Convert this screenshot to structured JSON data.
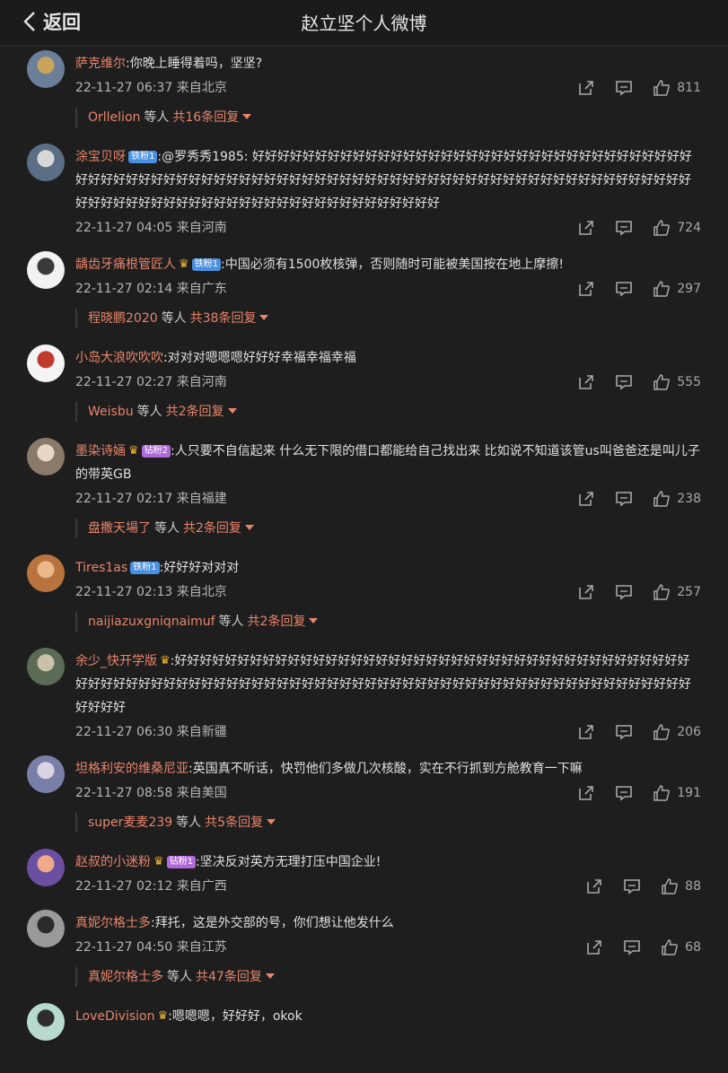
{
  "header": {
    "back_label": "返回",
    "title": "赵立坚个人微博"
  },
  "comments": [
    {
      "name": "萨克维尔",
      "badge": "",
      "crown": false,
      "text": ":你晚上睡得着吗，坚坚?",
      "time": "22-11-27 06:37 来自北京",
      "likes": "811",
      "reply_user": "Orllelion",
      "reply_mid": "等人",
      "reply_total": "共16条回复"
    },
    {
      "name": "涂宝贝呀",
      "badge": "铁粉1",
      "crown": false,
      "text": ":@罗秀秀1985: 好好好好好好好好好好好好好好好好好好好好好好好好好好好好好好好好好好好好好好好好好好好好好好好好好好好好好好好好好好好好好好好好好好好好好好好好好好好好好好好好好好好好好好好好好好好好好好好好好好好好好好好好好好好好好好好好好",
      "time": "22-11-27 04:05 来自河南",
      "likes": "724",
      "reply_user": "",
      "reply_mid": "",
      "reply_total": ""
    },
    {
      "name": "龋齿牙痛根管匠人",
      "badge": "铁粉1",
      "crown": true,
      "text": ":中国必须有1500枚核弹，否则随时可能被美国按在地上摩擦!",
      "time": "22-11-27 02:14 来自广东",
      "likes": "297",
      "reply_user": "程晓鹏2020",
      "reply_mid": "等人",
      "reply_total": "共38条回复"
    },
    {
      "name": "小岛大浪吹吹吹",
      "badge": "",
      "crown": false,
      "text": ":对对对嗯嗯嗯好好好幸福幸福幸福",
      "time": "22-11-27 02:27 来自河南",
      "likes": "555",
      "reply_user": "Weisbu",
      "reply_mid": "等人",
      "reply_total": "共2条回复"
    },
    {
      "name": "墨染诗婳",
      "badge": "钻粉2",
      "crown": true,
      "text": ":人只要不自信起来 什么无下限的借口都能给自己找出来 比如说不知道该管us叫爸爸还是叫儿子的带英GB",
      "time": "22-11-27 02:17 来自福建",
      "likes": "238",
      "reply_user": "盘撒天場了",
      "reply_mid": "等人",
      "reply_total": "共2条回复"
    },
    {
      "name": "Tires1as",
      "badge": "铁粉1",
      "crown": false,
      "text": ":好好好对对对",
      "time": "22-11-27 02:13 来自北京",
      "likes": "257",
      "reply_user": "naijiazuxgniqnaimuf",
      "reply_mid": "等人",
      "reply_total": "共2条回复"
    },
    {
      "name": "余少_快开学版",
      "badge": "",
      "crown": true,
      "text": ":好好好好好好好好好好好好好好好好好好好好好好好好好好好好好好好好好好好好好好好好好好好好好好好好好好好好好好好好好好好好好好好好好好好好好好好好好好好好好好好好好好好好好好好好好好好好好好",
      "time": "22-11-27 06:30 来自新疆",
      "likes": "206",
      "reply_user": "",
      "reply_mid": "",
      "reply_total": ""
    },
    {
      "name": "坦格利安的维桑尼亚",
      "badge": "",
      "crown": false,
      "text": ":英国真不听话，快罚他们多做几次核酸，实在不行抓到方舱教育一下嘛",
      "time": "22-11-27 08:58 来自美国",
      "likes": "191",
      "reply_user": "super麦麦239",
      "reply_mid": "等人",
      "reply_total": "共5条回复"
    },
    {
      "name": "赵叔的小迷粉",
      "badge": "钻粉1",
      "crown": true,
      "text": ":坚决反对英方无理打压中国企业!",
      "time": "22-11-27 02:12 来自广西",
      "likes": "88",
      "reply_user": "",
      "reply_mid": "",
      "reply_total": ""
    },
    {
      "name": "真妮尔格士多",
      "badge": "",
      "crown": false,
      "text": ":拜托，这是外交部的号，你们想让他发什么",
      "time": "22-11-27 04:50 来自江苏",
      "likes": "68",
      "reply_user": "真妮尔格士多",
      "reply_mid": "等人",
      "reply_total": "共47条回复"
    },
    {
      "name": "LoveDivision",
      "badge": "",
      "crown": true,
      "text": ":嗯嗯嗯，好好好，okok",
      "time": "",
      "likes": "",
      "reply_user": "",
      "reply_mid": "",
      "reply_total": ""
    }
  ]
}
